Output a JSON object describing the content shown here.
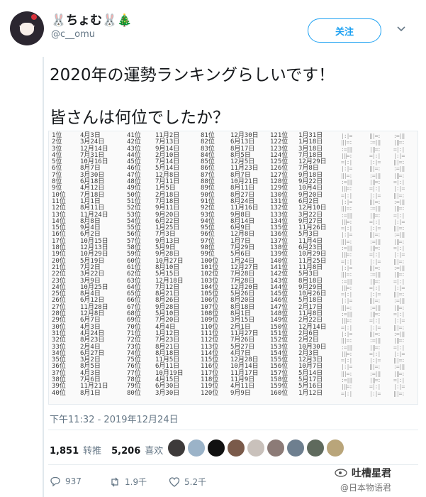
{
  "profile": {
    "display_name": "🐰ちょむ🐰🎄",
    "handle": "@c__omu",
    "follow_label": "关注"
  },
  "tweet": {
    "line1": "2020年の運勢ランキングらしいです！",
    "line2": "皆さんは何位でしたか？"
  },
  "media": {
    "columns": [
      {
        "ranks": [
          "1位",
          "2位",
          "3位",
          "4位",
          "5位",
          "6位",
          "7位",
          "8位",
          "9位",
          "10位",
          "11位",
          "12位",
          "13位",
          "14位",
          "15位",
          "16位",
          "17位",
          "18位",
          "19位",
          "20位",
          "21位",
          "22位",
          "23位",
          "24位",
          "25位",
          "26位",
          "27位",
          "28位",
          "29位",
          "30位",
          "31位",
          "32位",
          "33位",
          "34位",
          "35位",
          "36位",
          "37位",
          "38位",
          "39位",
          "40位"
        ],
        "dates": [
          "4月3日",
          "3月24日",
          "12月14日",
          "7月31日",
          "10月16日",
          "8月7日",
          "3月30日",
          "6月18日",
          "4月12日",
          "7月18日",
          "1月1日",
          "8月11日",
          "11月24日",
          "8月8日",
          "9月4日",
          "6月2日",
          "10月15日",
          "12月13日",
          "10月29日",
          "5月19日",
          "7月2日",
          "3月22日",
          "3月9日",
          "10月25日",
          "8月4日",
          "6月12日",
          "11月28日",
          "12月8日",
          "6月7日",
          "4月3日",
          "4月24日",
          "8月23日",
          "2月4日",
          "6月27日",
          "3月2日",
          "8月5日",
          "4月3日",
          "7月6日",
          "11月21日",
          "8月1日"
        ]
      },
      {
        "ranks": [
          "41位",
          "42位",
          "43位",
          "44位",
          "45位",
          "46位",
          "47位",
          "48位",
          "49位",
          "50位",
          "51位",
          "52位",
          "53位",
          "54位",
          "55位",
          "56位",
          "57位",
          "58位",
          "59位",
          "60位",
          "61位",
          "62位",
          "63位",
          "64位",
          "65位",
          "66位",
          "67位",
          "68位",
          "69位",
          "70位",
          "71位",
          "72位",
          "73位",
          "74位",
          "75位",
          "76位",
          "77位",
          "78位",
          "79位",
          "80位"
        ],
        "dates": [
          "11月2日",
          "7月13日",
          "9月14日",
          "2月10日",
          "7月14日",
          "5月14日",
          "12月8日",
          "7月11日",
          "1月5日",
          "2月18日",
          "7月18日",
          "9月11日",
          "9月20日",
          "6月22日",
          "1月25日",
          "7月3日",
          "9月13日",
          "5月9日",
          "9月28日",
          "10月27日",
          "8月10日",
          "5月15日",
          "12月18日",
          "7月12日",
          "8月21日",
          "8月26日",
          "9月28日",
          "5月10日",
          "7月20日",
          "4月4日",
          "1月12日",
          "7月23日",
          "8月21日",
          "8月18日",
          "11月5日",
          "6月11日",
          "10月19日",
          "4月15日",
          "6月30日",
          "3月30日"
        ]
      },
      {
        "ranks": [
          "81位",
          "82位",
          "83位",
          "84位",
          "85位",
          "86位",
          "87位",
          "88位",
          "89位",
          "90位",
          "91位",
          "92位",
          "93位",
          "94位",
          "95位",
          "96位",
          "97位",
          "98位",
          "99位",
          "100位",
          "101位",
          "102位",
          "103位",
          "104位",
          "105位",
          "106位",
          "107位",
          "108位",
          "109位",
          "110位",
          "111位",
          "112位",
          "113位",
          "114位",
          "115位",
          "116位",
          "117位",
          "118位",
          "119位",
          "120位"
        ],
        "dates": [
          "12月30日",
          "6月13日",
          "8月17日",
          "8月5日",
          "12月5日",
          "11月23日",
          "8月7日",
          "10月21日",
          "8月11日",
          "8月27日",
          "8月24日",
          "11月16日",
          "9月8日",
          "8月14日",
          "6月9日",
          "12月8日",
          "1月7日",
          "7月29日",
          "5月6日",
          "1月24日",
          "12月27日",
          "7月28日",
          "7月28日",
          "12月20日",
          "5月26日",
          "8月20日",
          "8月18日",
          "8月1日",
          "3月15日",
          "2月1日",
          "11月27日",
          "7月26日",
          "5月27日",
          "4月7日",
          "12月28日",
          "10月14日",
          "11月17日",
          "11月9日",
          "4月11日",
          "9月9日"
        ]
      },
      {
        "ranks": [
          "121位",
          "122位",
          "123位",
          "124位",
          "125位",
          "126位",
          "127位",
          "128位",
          "129位",
          "130位",
          "131位",
          "132位",
          "133位",
          "134位",
          "135位",
          "136位",
          "137位",
          "138位",
          "139位",
          "140位",
          "141位",
          "142位",
          "143位",
          "144位",
          "145位",
          "146位",
          "147位",
          "148位",
          "149位",
          "150位",
          "151位",
          "152位",
          "153位",
          "154位",
          "155位",
          "156位",
          "157位",
          "158位",
          "159位",
          "160位"
        ],
        "dates": [
          "1月31日",
          "1月18日",
          "3月18日",
          "7月18日",
          "12月29日",
          "7月8日",
          "9月18日",
          "9月22日",
          "10月4日",
          "9月20日",
          "6月2日",
          "12月10日",
          "3月22日",
          "9月27日",
          "11月26日",
          "5月3日",
          "11月4日",
          "6月23日",
          "10月29日",
          "11月25日",
          "11月8日",
          "5月3日",
          "8月18日",
          "9月29日",
          "10月26日",
          "5月18日",
          "2月17日",
          "11月8日",
          "2月22日",
          "12月14日",
          "2月6日",
          "2月2日",
          "10月30日",
          "2月3日",
          "12月3日",
          "10月7日",
          "5月14日",
          "5月17日",
          "5月16日",
          "1月12日"
        ]
      }
    ]
  },
  "timestamp": "下午11:32 - 2019年12月24日",
  "stats": {
    "retweets_count": "1,851",
    "retweets_label": "转推",
    "likes_count": "5,206",
    "likes_label": "喜欢"
  },
  "actions": {
    "reply_count": "937",
    "retweet_count": "1.9千",
    "like_count": "5.2千"
  },
  "watermark": {
    "line1": "吐槽星君",
    "line2": "@日本物语君"
  },
  "colors": {
    "accent": "#1da1f2",
    "muted": "#657786",
    "divider": "#e6ecf0"
  }
}
